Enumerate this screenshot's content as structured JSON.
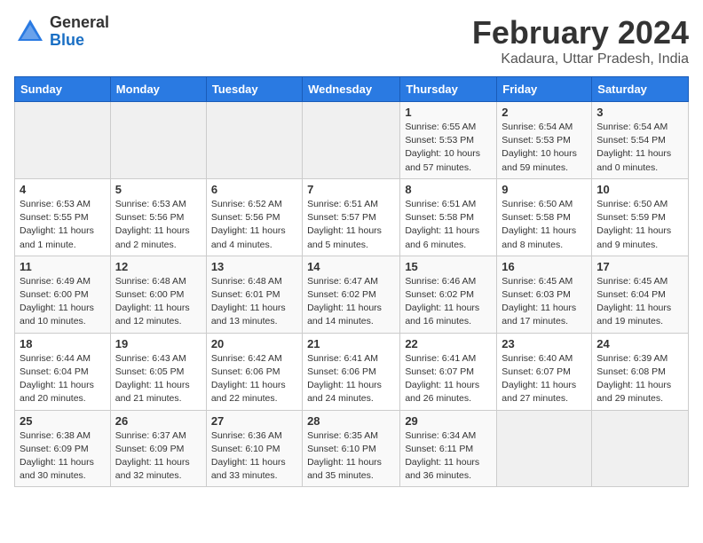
{
  "logo": {
    "general": "General",
    "blue": "Blue"
  },
  "title": {
    "month": "February 2024",
    "location": "Kadaura, Uttar Pradesh, India"
  },
  "header": {
    "days": [
      "Sunday",
      "Monday",
      "Tuesday",
      "Wednesday",
      "Thursday",
      "Friday",
      "Saturday"
    ]
  },
  "weeks": [
    [
      {
        "day": "",
        "info": ""
      },
      {
        "day": "",
        "info": ""
      },
      {
        "day": "",
        "info": ""
      },
      {
        "day": "",
        "info": ""
      },
      {
        "day": "1",
        "info": "Sunrise: 6:55 AM\nSunset: 5:53 PM\nDaylight: 10 hours\nand 57 minutes."
      },
      {
        "day": "2",
        "info": "Sunrise: 6:54 AM\nSunset: 5:53 PM\nDaylight: 10 hours\nand 59 minutes."
      },
      {
        "day": "3",
        "info": "Sunrise: 6:54 AM\nSunset: 5:54 PM\nDaylight: 11 hours\nand 0 minutes."
      }
    ],
    [
      {
        "day": "4",
        "info": "Sunrise: 6:53 AM\nSunset: 5:55 PM\nDaylight: 11 hours\nand 1 minute."
      },
      {
        "day": "5",
        "info": "Sunrise: 6:53 AM\nSunset: 5:56 PM\nDaylight: 11 hours\nand 2 minutes."
      },
      {
        "day": "6",
        "info": "Sunrise: 6:52 AM\nSunset: 5:56 PM\nDaylight: 11 hours\nand 4 minutes."
      },
      {
        "day": "7",
        "info": "Sunrise: 6:51 AM\nSunset: 5:57 PM\nDaylight: 11 hours\nand 5 minutes."
      },
      {
        "day": "8",
        "info": "Sunrise: 6:51 AM\nSunset: 5:58 PM\nDaylight: 11 hours\nand 6 minutes."
      },
      {
        "day": "9",
        "info": "Sunrise: 6:50 AM\nSunset: 5:58 PM\nDaylight: 11 hours\nand 8 minutes."
      },
      {
        "day": "10",
        "info": "Sunrise: 6:50 AM\nSunset: 5:59 PM\nDaylight: 11 hours\nand 9 minutes."
      }
    ],
    [
      {
        "day": "11",
        "info": "Sunrise: 6:49 AM\nSunset: 6:00 PM\nDaylight: 11 hours\nand 10 minutes."
      },
      {
        "day": "12",
        "info": "Sunrise: 6:48 AM\nSunset: 6:00 PM\nDaylight: 11 hours\nand 12 minutes."
      },
      {
        "day": "13",
        "info": "Sunrise: 6:48 AM\nSunset: 6:01 PM\nDaylight: 11 hours\nand 13 minutes."
      },
      {
        "day": "14",
        "info": "Sunrise: 6:47 AM\nSunset: 6:02 PM\nDaylight: 11 hours\nand 14 minutes."
      },
      {
        "day": "15",
        "info": "Sunrise: 6:46 AM\nSunset: 6:02 PM\nDaylight: 11 hours\nand 16 minutes."
      },
      {
        "day": "16",
        "info": "Sunrise: 6:45 AM\nSunset: 6:03 PM\nDaylight: 11 hours\nand 17 minutes."
      },
      {
        "day": "17",
        "info": "Sunrise: 6:45 AM\nSunset: 6:04 PM\nDaylight: 11 hours\nand 19 minutes."
      }
    ],
    [
      {
        "day": "18",
        "info": "Sunrise: 6:44 AM\nSunset: 6:04 PM\nDaylight: 11 hours\nand 20 minutes."
      },
      {
        "day": "19",
        "info": "Sunrise: 6:43 AM\nSunset: 6:05 PM\nDaylight: 11 hours\nand 21 minutes."
      },
      {
        "day": "20",
        "info": "Sunrise: 6:42 AM\nSunset: 6:06 PM\nDaylight: 11 hours\nand 22 minutes."
      },
      {
        "day": "21",
        "info": "Sunrise: 6:41 AM\nSunset: 6:06 PM\nDaylight: 11 hours\nand 24 minutes."
      },
      {
        "day": "22",
        "info": "Sunrise: 6:41 AM\nSunset: 6:07 PM\nDaylight: 11 hours\nand 26 minutes."
      },
      {
        "day": "23",
        "info": "Sunrise: 6:40 AM\nSunset: 6:07 PM\nDaylight: 11 hours\nand 27 minutes."
      },
      {
        "day": "24",
        "info": "Sunrise: 6:39 AM\nSunset: 6:08 PM\nDaylight: 11 hours\nand 29 minutes."
      }
    ],
    [
      {
        "day": "25",
        "info": "Sunrise: 6:38 AM\nSunset: 6:09 PM\nDaylight: 11 hours\nand 30 minutes."
      },
      {
        "day": "26",
        "info": "Sunrise: 6:37 AM\nSunset: 6:09 PM\nDaylight: 11 hours\nand 32 minutes."
      },
      {
        "day": "27",
        "info": "Sunrise: 6:36 AM\nSunset: 6:10 PM\nDaylight: 11 hours\nand 33 minutes."
      },
      {
        "day": "28",
        "info": "Sunrise: 6:35 AM\nSunset: 6:10 PM\nDaylight: 11 hours\nand 35 minutes."
      },
      {
        "day": "29",
        "info": "Sunrise: 6:34 AM\nSunset: 6:11 PM\nDaylight: 11 hours\nand 36 minutes."
      },
      {
        "day": "",
        "info": ""
      },
      {
        "day": "",
        "info": ""
      }
    ]
  ]
}
